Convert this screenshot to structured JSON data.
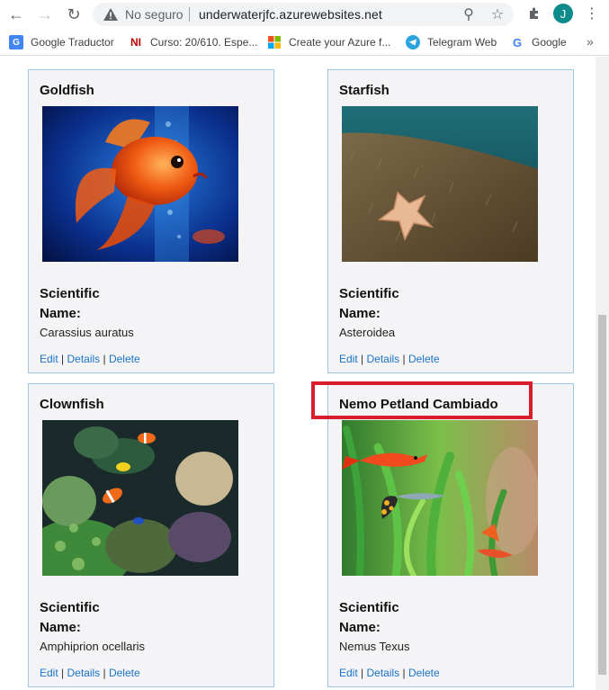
{
  "browser": {
    "insecure_label": "No seguro",
    "url": "underwaterjfc.azurewebsites.net",
    "avatar_letter": "J",
    "accent": "#0d8a8a"
  },
  "bookmarks": [
    {
      "label": "Google Traductor",
      "icon": "google-translate-icon"
    },
    {
      "label": "Curso: 20/610. Espe...",
      "icon": "ni-icon"
    },
    {
      "label": "Create your Azure f...",
      "icon": "microsoft-icon"
    },
    {
      "label": "Telegram Web",
      "icon": "telegram-icon"
    },
    {
      "label": "Google",
      "icon": "google-icon"
    }
  ],
  "cards": [
    {
      "title": "Goldfish",
      "sci_label": "Scientific Name:",
      "sci_value": "Carassius auratus",
      "image": "goldfish-image"
    },
    {
      "title": "Starfish",
      "sci_label": "Scientific Name:",
      "sci_value": "Asteroidea",
      "image": "starfish-image"
    },
    {
      "title": "Clownfish",
      "sci_label": "Scientific Name:",
      "sci_value": "Amphiprion ocellaris",
      "image": "clownfish-image"
    },
    {
      "title": "Nemo Petland Cambiado",
      "sci_label": "Scientific Name:",
      "sci_value": "Nemus Texus",
      "image": "guppy-image"
    }
  ],
  "links": {
    "edit": "Edit",
    "details": "Details",
    "delete": "Delete",
    "sep": " | "
  },
  "highlight_color": "#d81e2c"
}
